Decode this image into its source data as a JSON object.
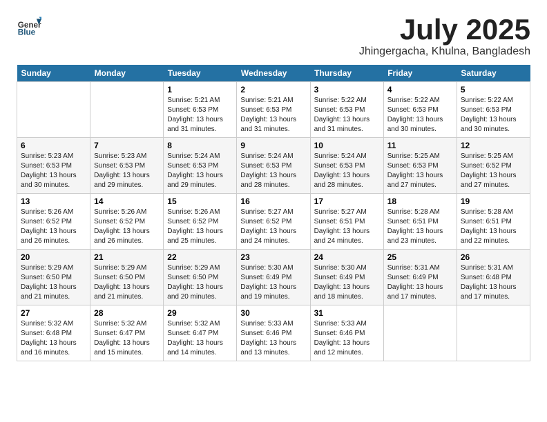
{
  "logo": {
    "general": "General",
    "blue": "Blue"
  },
  "title": "July 2025",
  "location": "Jhingergacha, Khulna, Bangladesh",
  "weekdays": [
    "Sunday",
    "Monday",
    "Tuesday",
    "Wednesday",
    "Thursday",
    "Friday",
    "Saturday"
  ],
  "weeks": [
    [
      {
        "day": "",
        "info": ""
      },
      {
        "day": "",
        "info": ""
      },
      {
        "day": "1",
        "info": "Sunrise: 5:21 AM\nSunset: 6:53 PM\nDaylight: 13 hours and 31 minutes."
      },
      {
        "day": "2",
        "info": "Sunrise: 5:21 AM\nSunset: 6:53 PM\nDaylight: 13 hours and 31 minutes."
      },
      {
        "day": "3",
        "info": "Sunrise: 5:22 AM\nSunset: 6:53 PM\nDaylight: 13 hours and 31 minutes."
      },
      {
        "day": "4",
        "info": "Sunrise: 5:22 AM\nSunset: 6:53 PM\nDaylight: 13 hours and 30 minutes."
      },
      {
        "day": "5",
        "info": "Sunrise: 5:22 AM\nSunset: 6:53 PM\nDaylight: 13 hours and 30 minutes."
      }
    ],
    [
      {
        "day": "6",
        "info": "Sunrise: 5:23 AM\nSunset: 6:53 PM\nDaylight: 13 hours and 30 minutes."
      },
      {
        "day": "7",
        "info": "Sunrise: 5:23 AM\nSunset: 6:53 PM\nDaylight: 13 hours and 29 minutes."
      },
      {
        "day": "8",
        "info": "Sunrise: 5:24 AM\nSunset: 6:53 PM\nDaylight: 13 hours and 29 minutes."
      },
      {
        "day": "9",
        "info": "Sunrise: 5:24 AM\nSunset: 6:53 PM\nDaylight: 13 hours and 28 minutes."
      },
      {
        "day": "10",
        "info": "Sunrise: 5:24 AM\nSunset: 6:53 PM\nDaylight: 13 hours and 28 minutes."
      },
      {
        "day": "11",
        "info": "Sunrise: 5:25 AM\nSunset: 6:53 PM\nDaylight: 13 hours and 27 minutes."
      },
      {
        "day": "12",
        "info": "Sunrise: 5:25 AM\nSunset: 6:52 PM\nDaylight: 13 hours and 27 minutes."
      }
    ],
    [
      {
        "day": "13",
        "info": "Sunrise: 5:26 AM\nSunset: 6:52 PM\nDaylight: 13 hours and 26 minutes."
      },
      {
        "day": "14",
        "info": "Sunrise: 5:26 AM\nSunset: 6:52 PM\nDaylight: 13 hours and 26 minutes."
      },
      {
        "day": "15",
        "info": "Sunrise: 5:26 AM\nSunset: 6:52 PM\nDaylight: 13 hours and 25 minutes."
      },
      {
        "day": "16",
        "info": "Sunrise: 5:27 AM\nSunset: 6:52 PM\nDaylight: 13 hours and 24 minutes."
      },
      {
        "day": "17",
        "info": "Sunrise: 5:27 AM\nSunset: 6:51 PM\nDaylight: 13 hours and 24 minutes."
      },
      {
        "day": "18",
        "info": "Sunrise: 5:28 AM\nSunset: 6:51 PM\nDaylight: 13 hours and 23 minutes."
      },
      {
        "day": "19",
        "info": "Sunrise: 5:28 AM\nSunset: 6:51 PM\nDaylight: 13 hours and 22 minutes."
      }
    ],
    [
      {
        "day": "20",
        "info": "Sunrise: 5:29 AM\nSunset: 6:50 PM\nDaylight: 13 hours and 21 minutes."
      },
      {
        "day": "21",
        "info": "Sunrise: 5:29 AM\nSunset: 6:50 PM\nDaylight: 13 hours and 21 minutes."
      },
      {
        "day": "22",
        "info": "Sunrise: 5:29 AM\nSunset: 6:50 PM\nDaylight: 13 hours and 20 minutes."
      },
      {
        "day": "23",
        "info": "Sunrise: 5:30 AM\nSunset: 6:49 PM\nDaylight: 13 hours and 19 minutes."
      },
      {
        "day": "24",
        "info": "Sunrise: 5:30 AM\nSunset: 6:49 PM\nDaylight: 13 hours and 18 minutes."
      },
      {
        "day": "25",
        "info": "Sunrise: 5:31 AM\nSunset: 6:49 PM\nDaylight: 13 hours and 17 minutes."
      },
      {
        "day": "26",
        "info": "Sunrise: 5:31 AM\nSunset: 6:48 PM\nDaylight: 13 hours and 17 minutes."
      }
    ],
    [
      {
        "day": "27",
        "info": "Sunrise: 5:32 AM\nSunset: 6:48 PM\nDaylight: 13 hours and 16 minutes."
      },
      {
        "day": "28",
        "info": "Sunrise: 5:32 AM\nSunset: 6:47 PM\nDaylight: 13 hours and 15 minutes."
      },
      {
        "day": "29",
        "info": "Sunrise: 5:32 AM\nSunset: 6:47 PM\nDaylight: 13 hours and 14 minutes."
      },
      {
        "day": "30",
        "info": "Sunrise: 5:33 AM\nSunset: 6:46 PM\nDaylight: 13 hours and 13 minutes."
      },
      {
        "day": "31",
        "info": "Sunrise: 5:33 AM\nSunset: 6:46 PM\nDaylight: 13 hours and 12 minutes."
      },
      {
        "day": "",
        "info": ""
      },
      {
        "day": "",
        "info": ""
      }
    ]
  ]
}
